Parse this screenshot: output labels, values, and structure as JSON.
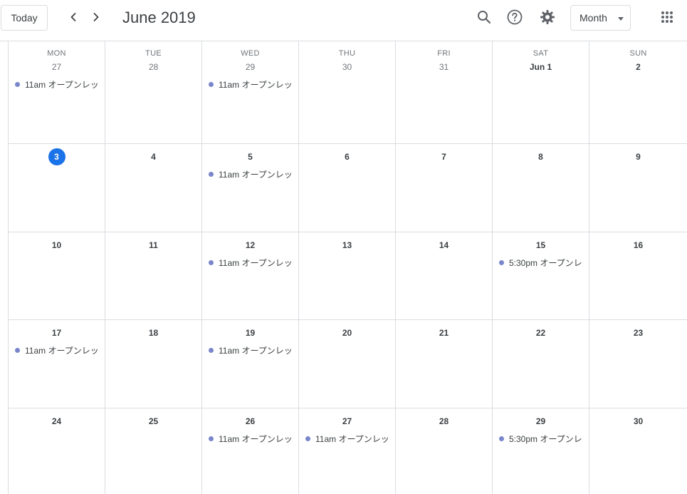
{
  "toolbar": {
    "today_label": "Today",
    "title": "June 2019",
    "view_label": "Month",
    "icons": {
      "prev": "chevron-left-icon",
      "next": "chevron-right-icon",
      "search": "search-icon",
      "help": "help-icon",
      "settings": "gear-icon",
      "apps": "apps-grid-icon"
    }
  },
  "colors": {
    "today_circle": "#1a73e8",
    "event_dot": "#7986cb",
    "grid_line": "#dadce0"
  },
  "calendar": {
    "weekdays": [
      "MON",
      "TUE",
      "WED",
      "THU",
      "FRI",
      "SAT",
      "SUN"
    ],
    "today": "3",
    "weeks": [
      [
        {
          "date": "27",
          "other": true,
          "events": [
            "11am オープンレッ"
          ]
        },
        {
          "date": "28",
          "other": true,
          "events": []
        },
        {
          "date": "29",
          "other": true,
          "events": [
            "11am オープンレッ"
          ]
        },
        {
          "date": "30",
          "other": true,
          "events": []
        },
        {
          "date": "31",
          "other": true,
          "events": []
        },
        {
          "date": "Jun 1",
          "other": false,
          "events": []
        },
        {
          "date": "2",
          "other": false,
          "events": []
        }
      ],
      [
        {
          "date": "3",
          "other": false,
          "events": []
        },
        {
          "date": "4",
          "other": false,
          "events": []
        },
        {
          "date": "5",
          "other": false,
          "events": [
            "11am オープンレッ"
          ]
        },
        {
          "date": "6",
          "other": false,
          "events": []
        },
        {
          "date": "7",
          "other": false,
          "events": []
        },
        {
          "date": "8",
          "other": false,
          "events": []
        },
        {
          "date": "9",
          "other": false,
          "events": []
        }
      ],
      [
        {
          "date": "10",
          "other": false,
          "events": []
        },
        {
          "date": "11",
          "other": false,
          "events": []
        },
        {
          "date": "12",
          "other": false,
          "events": [
            "11am オープンレッ"
          ]
        },
        {
          "date": "13",
          "other": false,
          "events": []
        },
        {
          "date": "14",
          "other": false,
          "events": []
        },
        {
          "date": "15",
          "other": false,
          "events": [
            "5:30pm オープンレ"
          ]
        },
        {
          "date": "16",
          "other": false,
          "events": []
        }
      ],
      [
        {
          "date": "17",
          "other": false,
          "events": [
            "11am オープンレッ"
          ]
        },
        {
          "date": "18",
          "other": false,
          "events": []
        },
        {
          "date": "19",
          "other": false,
          "events": [
            "11am オープンレッ"
          ]
        },
        {
          "date": "20",
          "other": false,
          "events": []
        },
        {
          "date": "21",
          "other": false,
          "events": []
        },
        {
          "date": "22",
          "other": false,
          "events": []
        },
        {
          "date": "23",
          "other": false,
          "events": []
        }
      ],
      [
        {
          "date": "24",
          "other": false,
          "events": []
        },
        {
          "date": "25",
          "other": false,
          "events": []
        },
        {
          "date": "26",
          "other": false,
          "events": [
            "11am オープンレッ"
          ]
        },
        {
          "date": "27",
          "other": false,
          "events": [
            "11am オープンレッ"
          ]
        },
        {
          "date": "28",
          "other": false,
          "events": []
        },
        {
          "date": "29",
          "other": false,
          "events": [
            "5:30pm オープンレ"
          ]
        },
        {
          "date": "30",
          "other": false,
          "events": []
        }
      ]
    ]
  }
}
